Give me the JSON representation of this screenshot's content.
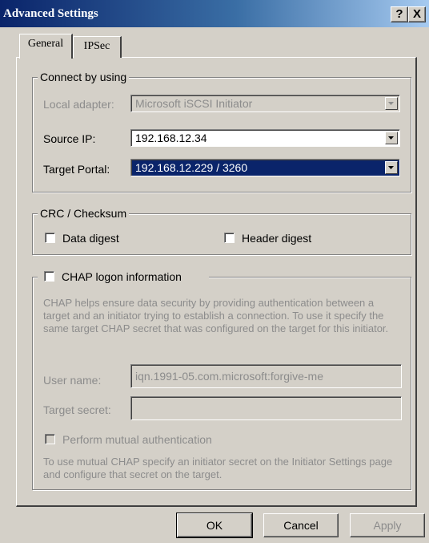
{
  "window": {
    "title": "Advanced Settings",
    "help_button": "?",
    "close_button": "X"
  },
  "tabs": [
    {
      "label": "General",
      "active": true
    },
    {
      "label": "IPSec",
      "active": false
    }
  ],
  "connect": {
    "legend": "Connect by using",
    "local_adapter_label": "Local adapter:",
    "local_adapter_value": "Microsoft iSCSI Initiator",
    "source_ip_label": "Source IP:",
    "source_ip_value": "192.168.12.34",
    "target_portal_label": "Target Portal:",
    "target_portal_value": "192.168.12.229 / 3260"
  },
  "crc": {
    "legend": "CRC / Checksum",
    "data_digest": "Data digest",
    "header_digest": "Header digest"
  },
  "chap": {
    "legend": "CHAP logon information",
    "description": "CHAP helps ensure data security by providing authentication between a target and an initiator trying to establish a connection. To use it specify the same target CHAP secret that was configured on the target for this initiator.",
    "user_name_label": "User name:",
    "user_name_value": "iqn.1991-05.com.microsoft:forgive-me",
    "target_secret_label": "Target secret:",
    "target_secret_value": "",
    "mutual_auth_label": "Perform mutual authentication",
    "mutual_note": "To use mutual CHAP specify an initiator secret on the Initiator Settings page and configure that secret on the target."
  },
  "buttons": {
    "ok": "OK",
    "cancel": "Cancel",
    "apply": "Apply"
  },
  "colors": {
    "titlebar_start": "#0a246a",
    "face": "#d4d0c8",
    "selection": "#0a246a",
    "disabled_text": "#8c8c8c"
  }
}
